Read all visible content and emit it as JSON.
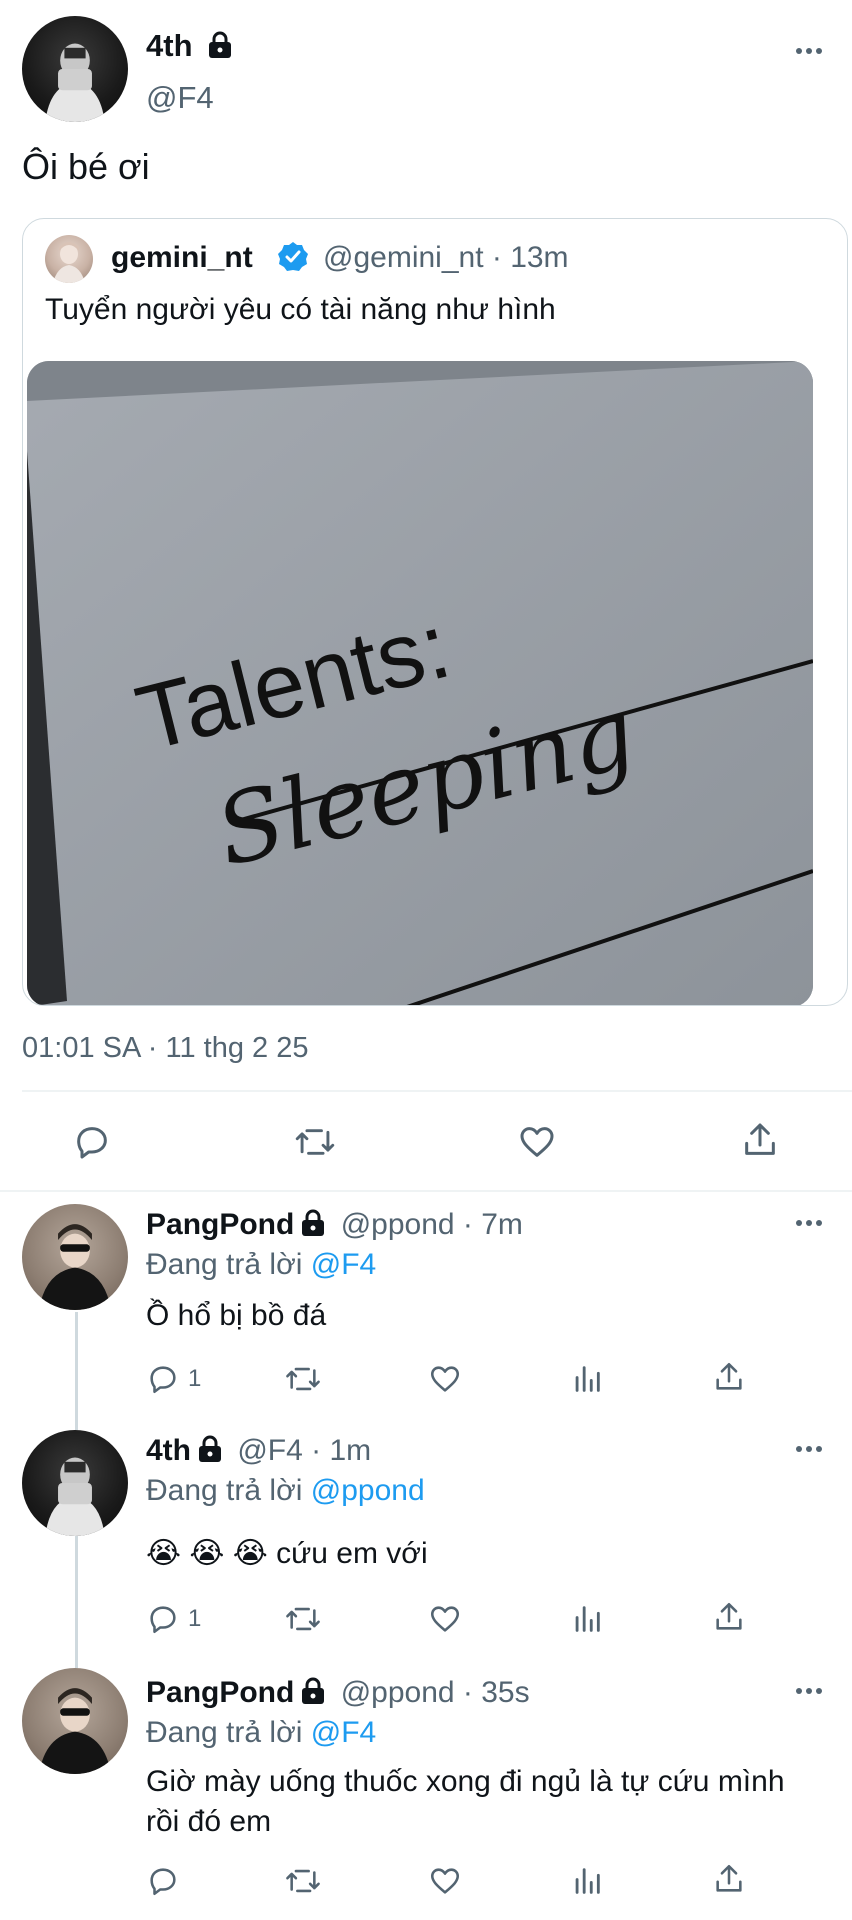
{
  "main_tweet": {
    "author_name": "4th",
    "author_handle": "@F4",
    "text": "Ôi bé ơi",
    "timestamp": "01:01 SA · 11 thg 2 25"
  },
  "quoted_tweet": {
    "author_name": "gemini_nt",
    "author_handle": "@gemini_nt · 13m",
    "text": "Tuyển người yêu có tài năng như hình",
    "image_text_line1": "Talents:",
    "image_text_line2": "Sleeping"
  },
  "replies": [
    {
      "author_name": "PangPond",
      "meta": "@ppond · 7m",
      "replying_label": "Đang trả lời ",
      "replying_to": "@F4",
      "text": "Ồ hổ bị bồ đá",
      "reply_count": "1"
    },
    {
      "author_name": "4th",
      "meta": "@F4 · 1m",
      "replying_label": "Đang trả lời ",
      "replying_to": "@ppond",
      "text": "😭 😭 😭 cứu em với",
      "reply_count": "1"
    },
    {
      "author_name": "PangPond",
      "meta": "@ppond · 35s",
      "replying_label": "Đang trả lời ",
      "replying_to": "@F4",
      "text": "Giờ mày uống thuốc xong đi ngủ là tự cứu mình rồi đó em",
      "reply_count": ""
    }
  ],
  "colors": {
    "text_primary": "#0f1419",
    "text_secondary": "#536471",
    "link": "#1d9bf0",
    "border": "#cfd9de",
    "divider": "#eff3f4",
    "verified": "#1d9bf0"
  },
  "icons": [
    "lock-icon",
    "more-icon",
    "verified-icon",
    "reply-icon",
    "retweet-icon",
    "like-icon",
    "share-icon",
    "analytics-icon"
  ]
}
